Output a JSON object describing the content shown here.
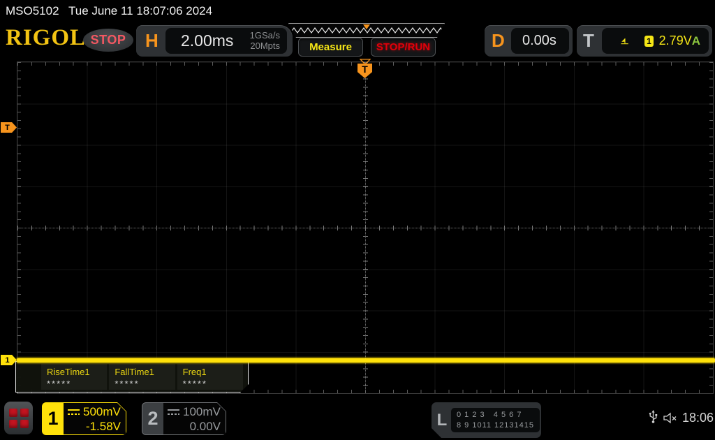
{
  "top_bar": {
    "model": "MSO5102",
    "datetime": "Tue June 11 18:07:06 2024"
  },
  "header": {
    "logo": "RIGOL",
    "run_state": "STOP",
    "horizontal": {
      "label": "H",
      "timebase": "2.00ms",
      "sample_rate": "1GSa/s",
      "memory_depth": "20Mpts"
    },
    "buttons": {
      "measure": "Measure",
      "stop_run": "STOP/RUN"
    },
    "delay": {
      "label": "D",
      "value": "0.00s"
    },
    "trigger": {
      "label": "T",
      "icon": "edge-rising-trigger-icon",
      "source": "1",
      "level": "2.79V",
      "mode": "A"
    }
  },
  "graticule": {
    "trigger_position_marker": "T",
    "trigger_level_marker": "T",
    "channel_marker": "1"
  },
  "measurement_overlay": {
    "items": [
      {
        "label": "RiseTime1",
        "value": "*****"
      },
      {
        "label": "FallTime1",
        "value": "*****"
      },
      {
        "label": "Freq1",
        "value": "*****"
      }
    ]
  },
  "bottom_bar": {
    "channel1": {
      "number": "1",
      "scale": "500mV",
      "offset": "-1.58V"
    },
    "channel2": {
      "number": "2",
      "scale": "100mV",
      "offset": "0.00V"
    },
    "logic": {
      "label": "L",
      "row1": "0 1 2 3   4 5 6 7",
      "row2": "8 9 1011 12131415"
    },
    "clock": "18:06"
  },
  "colors": {
    "accent_orange": "#f7941d",
    "channel1_yellow": "#ffe10a",
    "channel2_gray": "#989b9e",
    "stop_red": "#f25862",
    "run_red": "#e1000a",
    "trigger_mode_green": "#8cc63f"
  }
}
